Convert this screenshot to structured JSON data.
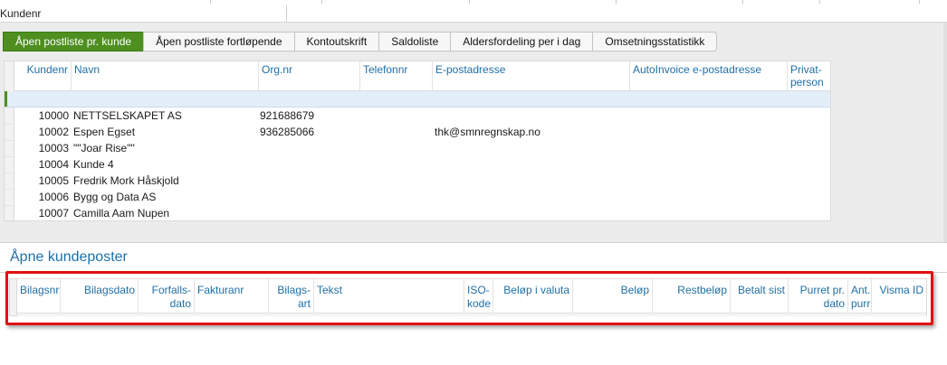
{
  "filter": {
    "label": "Kundenr"
  },
  "tabs": [
    {
      "label": "Åpen postliste pr. kunde",
      "active": true
    },
    {
      "label": "Åpen postliste fortløpende",
      "active": false
    },
    {
      "label": "Kontoutskrift",
      "active": false
    },
    {
      "label": "Saldoliste",
      "active": false
    },
    {
      "label": "Aldersfordeling per i dag",
      "active": false
    },
    {
      "label": "Omsetningsstatistikk",
      "active": false
    }
  ],
  "customer_grid": {
    "columns": [
      "Kundenr",
      "Navn",
      "Org.nr",
      "Telefonnr",
      "E-postadresse",
      "AutoInvoice e-postadresse",
      "Privat-\nperson"
    ],
    "rows": [
      {
        "kundenr": "10000",
        "navn": "NETTSELSKAPET AS",
        "orgnr": "921688679",
        "epost": ""
      },
      {
        "kundenr": "10002",
        "navn": "Espen Egset",
        "orgnr": "936285066",
        "epost": "thk@smnregnskap.no"
      },
      {
        "kundenr": "10003",
        "navn": "\"\"Joar Rise\"\"",
        "orgnr": "",
        "epost": ""
      },
      {
        "kundenr": "10004",
        "navn": "Kunde 4",
        "orgnr": "",
        "epost": ""
      },
      {
        "kundenr": "10005",
        "navn": "Fredrik Mork Håskjold",
        "orgnr": "",
        "epost": ""
      },
      {
        "kundenr": "10006",
        "navn": "Bygg og Data AS",
        "orgnr": "",
        "epost": ""
      },
      {
        "kundenr": "10007",
        "navn": "Camilla Aam Nupen",
        "orgnr": "",
        "epost": ""
      }
    ]
  },
  "open_items": {
    "title": "Åpne kundeposter",
    "columns": [
      "Bilagsnr",
      "Bilagsdato",
      "Forfalls-\ndato",
      "Fakturanr",
      "Bilags-\nart",
      "Tekst",
      "ISO-\nkode",
      "Beløp i valuta",
      "Beløp",
      "Restbeløp",
      "Betalt sist",
      "Purret pr.\ndato",
      "Ant.\npurr",
      "Visma ID"
    ]
  },
  "colors": {
    "accent_green": "#4e8f1f",
    "header_blue": "#1f6fa6",
    "highlight_red": "#e01010"
  }
}
